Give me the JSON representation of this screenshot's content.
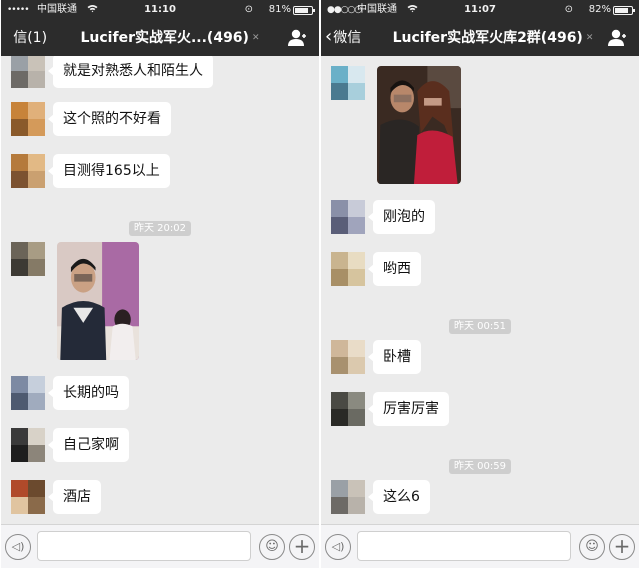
{
  "left_phone": {
    "status_bar": {
      "signal": "•••••",
      "carrier": "中国联通",
      "wifi_icon": "wifi-icon",
      "time": "11:10",
      "battery": "81%",
      "battery_level": 0.81
    },
    "nav": {
      "back_label": "信(1)",
      "title": "Lucifer实战军火...(496)",
      "mute_icon": "mute-icon",
      "people_icon": "people-icon"
    },
    "messages": [
      {
        "type": "text",
        "text": "就是对熟悉人和陌生人"
      },
      {
        "type": "text",
        "text": "这个照的不好看"
      },
      {
        "type": "text",
        "text": "目测得165以上"
      },
      {
        "type": "timestamp",
        "text": "昨天 20:02"
      },
      {
        "type": "image",
        "description_icon": "photo-of-man-icon"
      },
      {
        "type": "text",
        "text": "长期的吗"
      },
      {
        "type": "text",
        "text": "自己家啊"
      },
      {
        "type": "text",
        "text": "酒店"
      }
    ],
    "input_bar": {
      "voice_icon": "voice-icon",
      "emoji_icon": "emoji-icon",
      "plus_icon": "plus-icon",
      "value": "",
      "placeholder": ""
    }
  },
  "right_phone": {
    "status_bar": {
      "signal": "●●○○○",
      "carrier": "中国联通",
      "wifi_icon": "wifi-icon",
      "time": "11:07",
      "battery": "82%",
      "battery_level": 0.82
    },
    "nav": {
      "back_label": "微信",
      "title": "Lucifer实战军火库2群(496)",
      "mute_icon": "mute-icon",
      "people_icon": "people-icon"
    },
    "messages": [
      {
        "type": "image",
        "description_icon": "photo-of-couple-icon"
      },
      {
        "type": "text",
        "text": "刚泡的"
      },
      {
        "type": "text",
        "text": "哟西"
      },
      {
        "type": "timestamp",
        "text": "昨天 00:51"
      },
      {
        "type": "text",
        "text": "卧槽"
      },
      {
        "type": "text",
        "text": "厉害厉害"
      },
      {
        "type": "timestamp",
        "text": "昨天 00:59"
      },
      {
        "type": "text",
        "text": "这么6"
      }
    ],
    "input_bar": {
      "voice_icon": "voice-icon",
      "emoji_icon": "emoji-icon",
      "plus_icon": "plus-icon",
      "value": "",
      "placeholder": ""
    }
  },
  "colors": {
    "header_bg": "#2c2c2c",
    "chat_bg": "#ebebeb",
    "bubble_bg": "#ffffff",
    "timestamp_bg": "#cecece",
    "input_bar_bg": "#f4f4f6"
  }
}
